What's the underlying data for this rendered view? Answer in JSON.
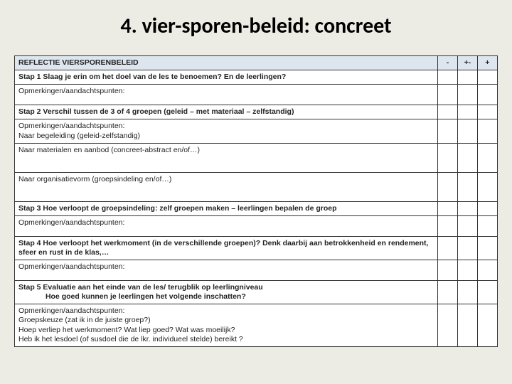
{
  "slide": {
    "title": "4. vier-sporen-beleid: concreet"
  },
  "header": {
    "label": "REFLECTIE   VIERSPORENBELEID",
    "col_minus": "-",
    "col_pm": "+-",
    "col_plus": "+"
  },
  "rows": {
    "step1": "Stap 1    Slaag je erin om het doel van de les te benoemen? En de leerlingen?",
    "op1": "Opmerkingen/aandachtspunten:",
    "step2": "Stap 2    Verschil tussen de 3 of 4 groepen (geleid – met materiaal – zelfstandig)",
    "s2a": "Opmerkingen/aandachtspunten:",
    "s2b": "Naar begeleiding (geleid-zelfstandig)",
    "s2c": "Naar materialen en aanbod (concreet-abstract  en/of…)",
    "s2d": "Naar organisatievorm  (groepsindeling en/of…)",
    "step3": "Stap 3    Hoe verloopt de groepsindeling:  zelf groepen maken – leerlingen bepalen de groep",
    "op3": "Opmerkingen/aandachtspunten:",
    "step4": "Stap 4    Hoe verloopt het werkmoment (in de verschillende groepen)?   Denk daarbij aan betrokkenheid en rendement,  sfeer en rust in de klas,…",
    "op4": "Opmerkingen/aandachtspunten:",
    "step5a": "Stap 5    Evaluatie aan het einde van de les/ terugblik op leerlingniveau",
    "step5b": "Hoe goed kunnen je leerlingen het volgende inschatten?",
    "op5a": "Opmerkingen/aandachtspunten:",
    "op5b": "Groepskeuze (zat ik in de juiste groep?)",
    "op5c": "Hoep verliep het werkmoment?  Wat liep goed? Wat was moeilijk?",
    "op5d": "Heb ik het lesdoel (of susdoel die de lkr. individueel stelde) bereikt ?"
  }
}
